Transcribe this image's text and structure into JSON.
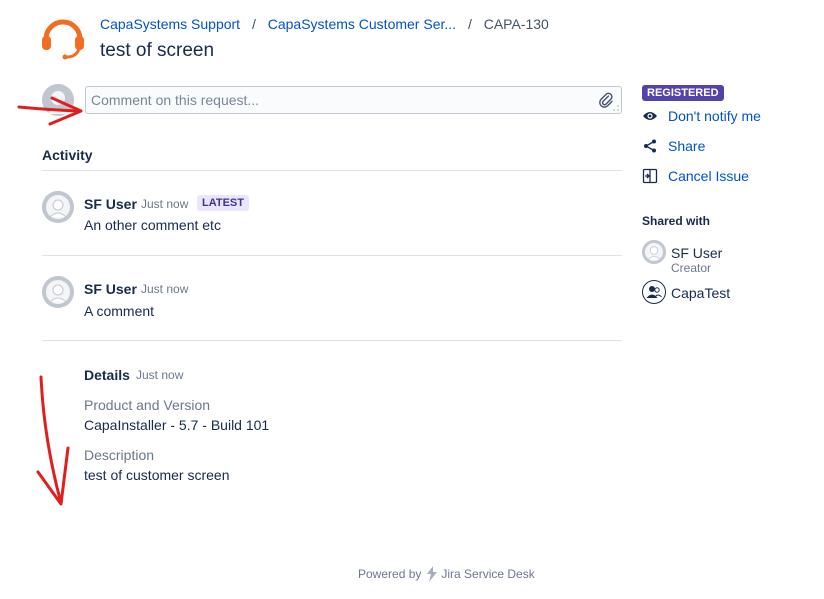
{
  "header": {
    "breadcrumb": [
      {
        "label": "CapaSystems Support"
      },
      {
        "label": "CapaSystems Customer Ser..."
      }
    ],
    "breadcrumb_current": "CAPA-130",
    "title": "test of screen"
  },
  "comment_input": {
    "placeholder": "Comment on this request..."
  },
  "activity": {
    "heading": "Activity",
    "comments": [
      {
        "author": "SF User",
        "time": "Just now",
        "badge": "LATEST",
        "text": "An other comment etc"
      },
      {
        "author": "SF User",
        "time": "Just now",
        "text": "A comment"
      }
    ],
    "details": {
      "label": "Details",
      "time": "Just now",
      "fields": [
        {
          "label": "Product and Version",
          "value": "CapaInstaller - 5.7 - Build 101"
        },
        {
          "label": "Description",
          "value": "test of customer screen"
        }
      ]
    }
  },
  "sidebar": {
    "status": "REGISTERED",
    "actions": [
      {
        "label": "Don't notify me",
        "icon": "eye-icon"
      },
      {
        "label": "Share",
        "icon": "share-icon"
      },
      {
        "label": "Cancel Issue",
        "icon": "cancel-issue-icon"
      }
    ],
    "shared_with": {
      "heading": "Shared with",
      "people": [
        {
          "name": "SF User",
          "role": "Creator"
        },
        {
          "name": "CapaTest"
        }
      ]
    }
  },
  "footer": {
    "prefix": "Powered by",
    "product": "Jira Service Desk"
  },
  "colors": {
    "link": "#0052cc",
    "text": "#172b4d",
    "muted": "#6b778c",
    "registered_badge": "#5243aa",
    "latest_badge_bg": "#eae6ff",
    "logo": "#f26c21",
    "annotation": "#e01e1e"
  }
}
